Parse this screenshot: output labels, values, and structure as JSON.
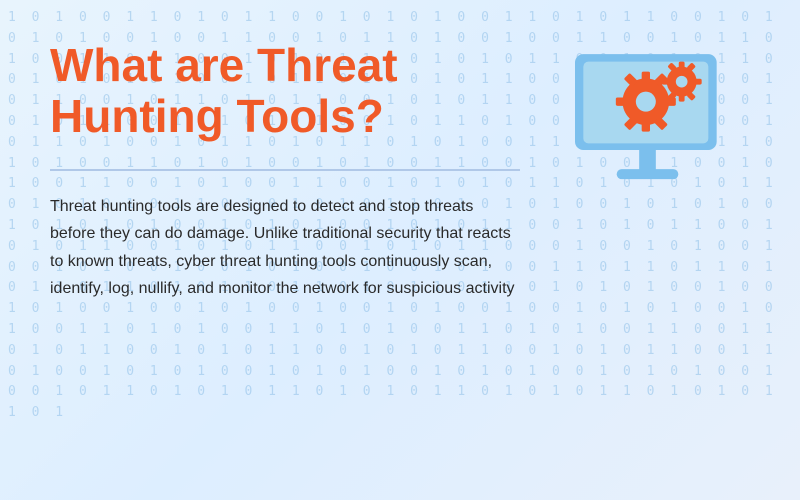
{
  "page": {
    "title": "What are Threat Hunting Tools?",
    "description": "Threat hunting tools are designed to detect and stop threats before they can do damage. Unlike traditional security that reacts to known threats, cyber threat hunting tools continuously scan, identify, log, nullify, and monitor the network for suspicious activity",
    "colors": {
      "title": "#f05a28",
      "text": "#2a2a2a",
      "monitor_screen": "#7bbfed",
      "gear_primary": "#f05a28",
      "gear_secondary": "#f05a28",
      "binary": "#90c0e8",
      "background_start": "#e8f4fd",
      "background_end": "#e8f0fb"
    },
    "binary_rows": [
      "1 0 1 0 0 1 1 0 1 0 1 1 0 0 1 0 1 0 1 0 0 1 1 0 1 0 1 1 0 0 1 0 1 0 1",
      "0 1 0 0 1 0 0 1 1 0 0 1 0 1 1 0 1 0 0 1 0 0 1 1 0 0 1 0 1 1 0 1 0 0 1",
      "1 0 1 1 0 0 1 0 1 0 1 1 0 0 1 0 1 0 1 1 0 0 1 0 1 0 1 1 0 0 1 0 1 0 1",
      "0 1 0 0 1 0 1 1 0 1 0 0 1 0 1 1 0 0 1 0 1 1 0 1 0 0 1 0 1 1 0 0 1 0 1",
      "1 0 1 0 1 1 0 0 1 0 1 0 1 1 0 0 1 0 1 0 1 1 0 0 1 0 1 0 1 1 0 0 1 0 1",
      "0 1 0 1 0 0 1 0 1 1 0 1 0 0 1 0 1 1 0 1 0 0 1 0 1 1 0 1 0 0 1 0 1 1 0",
      "1 0 1 1 0 1 0 1 0 0 1 1 0 1 0 1 0 0 1 1 0 1 0 1 0 0 1 1 0 1 0 1 0 0 1",
      "0 1 0 0 1 1 0 0 1 0 1 0 0 1 1 0 0 1 0 1 0 0 1 1 0 0 1 0 1 0 0 1 1 0 0",
      "1 0 1 0 1 0 1 1 0 1 0 1 0 1 0 1 1 0 1 0 1 0 1 0 1 1 0 1 0 1 0 1 0 1 1",
      "0 1 0 1 0 1 0 0 1 0 1 0 1 0 0 1 0 1 0 1 0 1 0 0 1 0 1 0 1 0 0 1 0 1 0",
      "1 1 0 0 1 0 1 0 1 1 0 0 1 0 1 0 1 1 0 0 1 0 1 0 1 1 0 0 1 0 1 0 1 1 0",
      "0 0 1 0 0 1 0 1 0 0 1 0 0 1 0 1 0 0 1 0 0 1 0 1 0 0 1 0 0 1 0 1 0 0 1",
      "1 0 1 1 0 1 1 0 1 0 1 1 0 1 1 0 1 0 1 1 0 1 1 0 1 0 1 1 0 1 1 0 1 0 1",
      "0 1 0 0 1 0 0 1 0 1 0 0 1 0 0 1 0 1 0 0 1 0 0 1 0 1 0 0 1 0 0 1 0 1 0",
      "1 0 0 1 0 1 0 0 1 1 0 1 0 1 0 0 1 1 0 1 0 1 0 0 1 1 0 1 0 1 0 0 1 1 0",
      "0 1 1 0 1 0 1 1 0 0 1 0 1 0 1 1 0 0 1 0 1 0 1 1 0 0 1 0 1 0 1 1 0 0 1",
      "1 0 1 0 0 1 0 1 0 1 0 0 1 0 1 0 1 0 0 1 0 1 0 1 0 0 1 0 1 0 1 0 0 1 0",
      "0 1 0 1 1 0 1 0 1 0 1 1 0 1 0 1 0 1 1 0 1 0 1 0 1 1 0 1 0 1 0 1 1 0 1"
    ]
  }
}
